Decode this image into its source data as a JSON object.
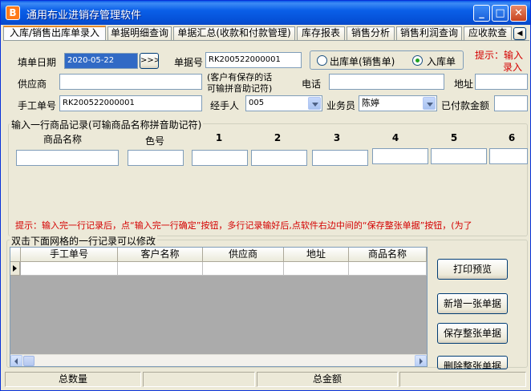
{
  "window": {
    "title": "通用布业进销存管理软件",
    "icon_glyph": "B",
    "min_glyph": "_",
    "max_glyph": "□",
    "close_glyph": "✕"
  },
  "tabs": [
    {
      "label": "入库/销售出库单录入",
      "active": true
    },
    {
      "label": "单据明细查询",
      "active": false
    },
    {
      "label": "单据汇总(收款和付款管理)",
      "active": false
    },
    {
      "label": "库存报表",
      "active": false
    },
    {
      "label": "销售分析",
      "active": false
    },
    {
      "label": "销售利润查询",
      "active": false
    },
    {
      "label": "应收款查",
      "active": false
    }
  ],
  "form": {
    "date_label": "填单日期",
    "date_value": "2020-05-22",
    "date_button": ">>>",
    "doc_no_label": "单据号",
    "doc_no_value": "RK200522000001",
    "radio_out_label": "出库单(销售单)",
    "radio_in_label": "入库单",
    "hint_top": "提示：输入",
    "hint_top2": "录入",
    "supplier_label": "供应商",
    "supplier_value": "",
    "customer_hint_1": "(客户有保存的话",
    "customer_hint_2": "可输拼音助记符)",
    "phone_label": "电话",
    "phone_value": "",
    "address_label": "地址",
    "address_value": "",
    "manual_no_label": "手工单号",
    "manual_no_value": "RK200522000001",
    "handler_label": "经手人",
    "handler_value": "005",
    "salesman_label": "业务员",
    "salesman_value": "陈婷",
    "paid_label": "已付款金额",
    "paid_value": ""
  },
  "entry": {
    "group_title": "输入一行商品记录(可输商品名称拼音助记符)",
    "columns": [
      "商品名称",
      "色号",
      "1",
      "2",
      "3",
      "4",
      "5",
      "6"
    ],
    "hint": "提示：输入完一行记录后，点“输入完一行确定”按钮，多行记录输好后,点软件右边中间的“保存整张单据”按钮，(为了"
  },
  "grid": {
    "group_title": "双击下面网格的一行记录可以修改",
    "columns": [
      "手工单号",
      "客户名称",
      "供应商",
      "地址",
      "商品名称"
    ]
  },
  "actions": {
    "print_preview": "打印预览",
    "new_doc": "新增一张单据",
    "save_doc": "保存整张单据",
    "delete_doc": "删除整张单据"
  },
  "status": {
    "total_qty_label": "总数量",
    "total_amount_label": "总金额"
  },
  "colors": {
    "title_bar": "#0a58e8",
    "hint_red": "#d40000",
    "selection_blue": "#316ac5"
  }
}
